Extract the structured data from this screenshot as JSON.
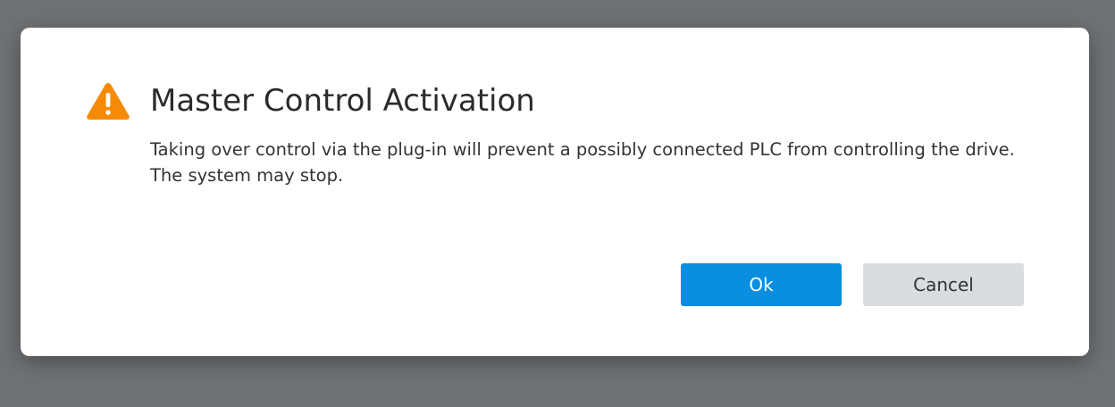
{
  "dialog": {
    "icon": "warning-triangle-icon",
    "icon_color": "#f58a07",
    "title": "Master Control Activation",
    "message": "Taking over control via the plug-in will prevent a possibly connected PLC from controlling the drive. The system may stop.",
    "ok_label": "Ok",
    "cancel_label": "Cancel",
    "ok_color": "#0a8ee0",
    "cancel_color": "#d9dce1"
  }
}
